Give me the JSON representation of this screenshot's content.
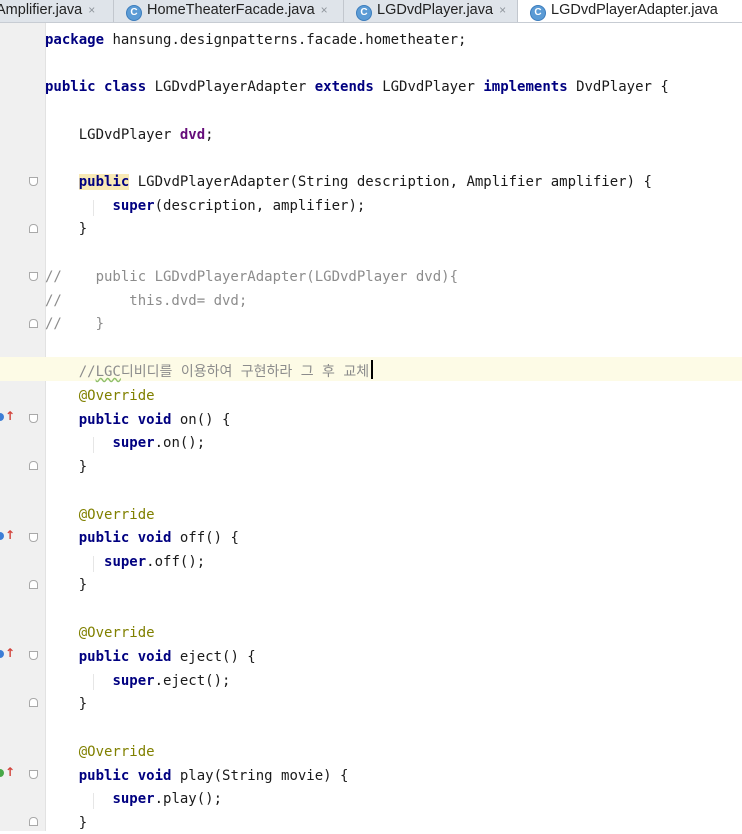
{
  "tabs": [
    {
      "label": "Amplifier.java",
      "icon": "class-icon",
      "active": false
    },
    {
      "label": "HomeTheaterFacade.java",
      "icon": "class-icon",
      "active": false
    },
    {
      "label": "LGDvdPlayer.java",
      "icon": "class-icon",
      "active": false
    },
    {
      "label": "LGDvdPlayerAdapter.java",
      "icon": "class-icon",
      "active": true
    }
  ],
  "tab_icon_glyph": "C",
  "close_glyph": "×",
  "code": {
    "package_kw": "package",
    "package_name": " hansung.designpatterns.facade.hometheater;",
    "class_kw1": "public",
    "class_kw2": "class",
    "class_name": " LGDvdPlayerAdapter ",
    "extends_kw": "extends",
    "base_class": " LGDvdPlayer ",
    "implements_kw": "implements",
    "iface": " DvdPlayer {",
    "field_type": "LGDvdPlayer ",
    "field_name": "dvd",
    "field_end": ";",
    "ctor_kw": "public",
    "ctor_sig": " LGDvdPlayerAdapter(String description, Amplifier amplifier) {",
    "super_kw": "super",
    "super_args": "(description, amplifier);",
    "close_brace": "}",
    "comment1": "//    public LGDvdPlayerAdapter(LGDvdPlayer dvd){",
    "comment2": "//        this.dvd= dvd;",
    "comment3": "//    }",
    "todo_prefix": "//",
    "todo_underlined": "LGC",
    "todo_rest": "디비디를 이용하여 구현하라 그 후 교체",
    "override": "@Override",
    "pub_void": "public void",
    "on_sig": " on() {",
    "on_call": ".on();",
    "off_sig": " off() {",
    "off_call": ".off();",
    "eject_sig": " eject() {",
    "eject_call": ".eject();",
    "play_sig": " play(String movie) {",
    "play_call": ".play();"
  }
}
